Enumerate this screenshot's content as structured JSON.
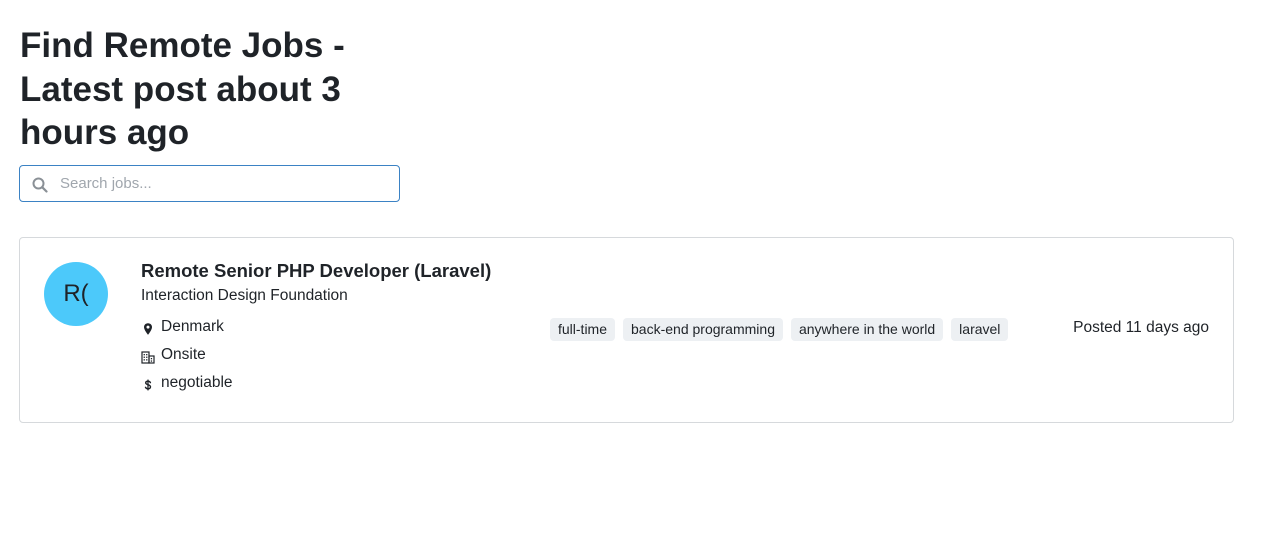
{
  "page": {
    "heading": "Find Remote Jobs - Latest post about 3 hours ago"
  },
  "search": {
    "placeholder": "Search jobs...",
    "value": "",
    "icon": "search-icon"
  },
  "jobs": [
    {
      "avatar_text": "R(",
      "avatar_color": "#4cc9fa",
      "title": "Remote Senior PHP Developer (Laravel)",
      "company": "Interaction Design Foundation",
      "location": "Denmark",
      "location_icon": "map-pin-icon",
      "workplace": "Onsite",
      "workplace_icon": "building-icon",
      "salary": "negotiable",
      "salary_icon": "dollar-icon",
      "tags": [
        "full-time",
        "back-end programming",
        "anywhere in the world",
        "laravel"
      ],
      "posted": "Posted 11 days ago"
    }
  ],
  "colors": {
    "accent": "#3b82c4",
    "tag_bg": "#edf0f3",
    "border": "#d6d9dc"
  }
}
